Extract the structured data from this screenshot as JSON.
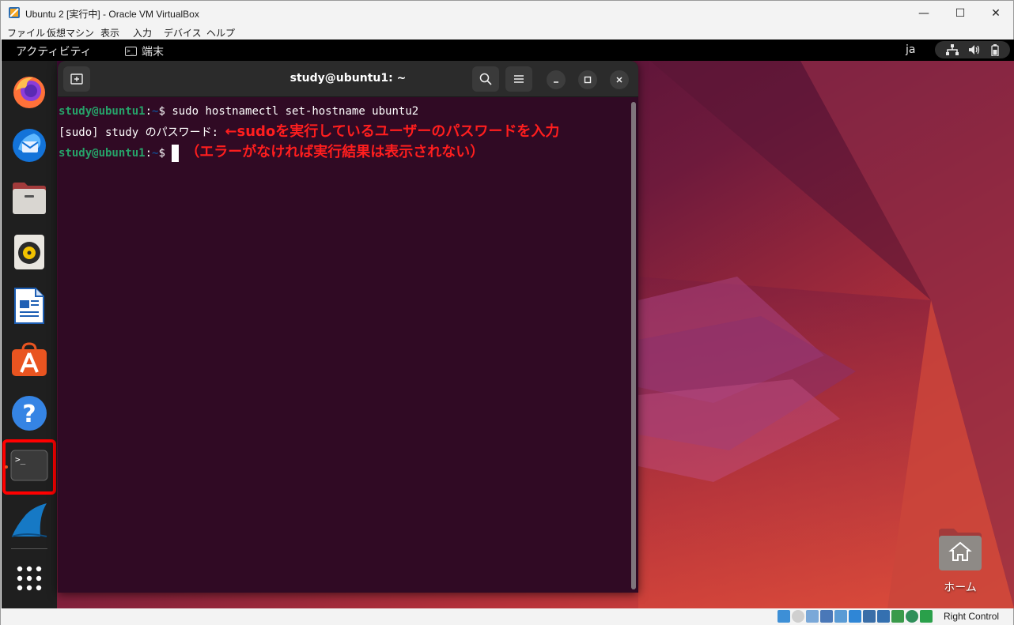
{
  "window": {
    "title": "Ubuntu 2 [実行中] - Oracle VM VirtualBox",
    "minimize_label": "—",
    "maximize_label": "☐",
    "close_label": "✕"
  },
  "menubar": {
    "items": [
      "ファイル",
      "仮想マシン",
      "表示",
      "入力",
      "デバイス",
      "ヘルプ"
    ]
  },
  "topbar": {
    "activities": "アクティビティ",
    "app_name": "端末",
    "input_lang": "ja",
    "tray_icons": [
      "network-icon",
      "volume-icon",
      "battery-icon"
    ]
  },
  "dock": {
    "items": [
      "Firefox",
      "Thunderbird",
      "Files",
      "Rhythmbox",
      "LibreOffice Writer",
      "Ubuntu Software",
      "Help",
      "Terminal",
      "Wireshark"
    ],
    "app_grid_icon": "app-grid-icon",
    "highlight_color": "#ff0000"
  },
  "terminal": {
    "title": "study@ubuntu1: ~",
    "lines": [
      {
        "prompt_user": "study@ubuntu1",
        "prompt_sep": ":",
        "prompt_path": "~",
        "prompt_end": "$ ",
        "text": "sudo hostnamectl set-hostname ubuntu2"
      },
      {
        "text": "[sudo] study のパスワード: ",
        "annotation": "←sudoを実行しているユーザーのパスワードを入力"
      },
      {
        "prompt_user": "study@ubuntu1",
        "prompt_sep": ":",
        "prompt_path": "~",
        "prompt_end": "$ ",
        "annotation": "（エラーがなければ実行結果は表示されない）"
      }
    ]
  },
  "desktop": {
    "home_label": "ホーム"
  },
  "statusbar": {
    "host_key": "Right Control"
  },
  "colors": {
    "terminal_bg": "#300a24",
    "prompt_green": "#26a269",
    "prompt_blue": "#12488b",
    "annotation_red": "#ff1e1e",
    "ubuntu_orange": "#e95420"
  }
}
